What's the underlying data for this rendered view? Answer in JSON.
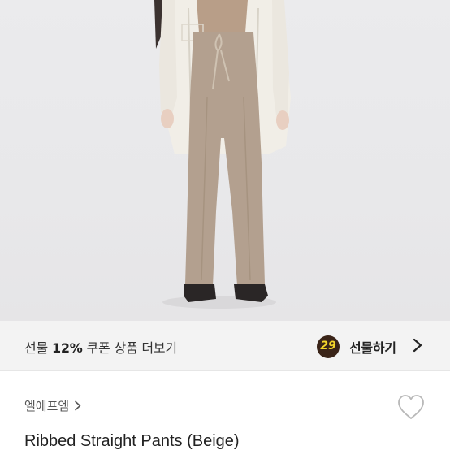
{
  "photo": {
    "alt_icon": "product-photo"
  },
  "gift_bar": {
    "prefix": "선물 ",
    "percent": "12%",
    "suffix": " 쿠폰 상품 더보기",
    "badge_number": "29",
    "action_label": "선물하기",
    "badge_color": "#3a2418",
    "badge_text_color": "#f4d62a"
  },
  "product": {
    "brand": "엘에프엠",
    "title": "Ribbed Straight Pants (Beige)"
  }
}
